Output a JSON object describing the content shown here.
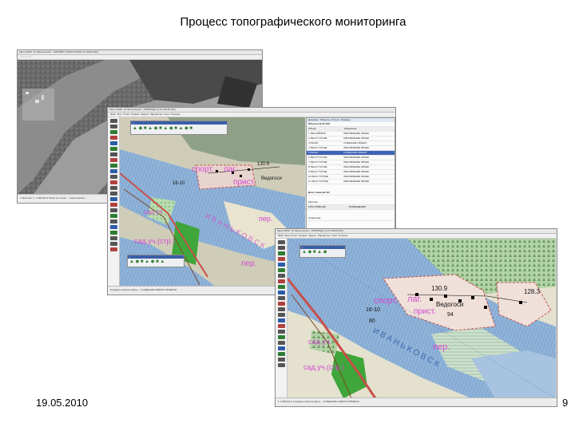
{
  "slide": {
    "title": "Процесс топографического мониторинга",
    "date": "19.05.2010",
    "page_number": "9"
  },
  "screens": {
    "satellite": {
      "window_title": "Карта 2008 - [С:\\Мониторинг\\...\\ОРЛОВО (С\\РИСУНОК\\0-37-109-В-3(Р)]",
      "status": "1 Ярослав. 1 : 9 000,00 м   Поиск по слоям ...  Тематическое ..."
    },
    "middle": {
      "window_title": "Карта 2008 - [С:\\Мониторинг\\...\\ПРИРОДА (0-37-109-В-3(Р)]",
      "menu": [
        "Файл",
        "Вид",
        "Поиск",
        "Правка",
        "Задачи",
        "Параметры",
        "Окно",
        "Помощь"
      ],
      "status": "Создание объекта карты -- СОЗДАНИЕ НОВОГО ОБЪЕКТА",
      "panel_tabs": [
        "Документ",
        "Объекты",
        "Отчеты",
        "Помощь"
      ],
      "panel_heading": "Объекты В-37-109",
      "columns": [
        "Объект",
        "Изменение"
      ],
      "objects": [
        {
          "name": "1 ЛЕССИЙ/ЕЛЬ",
          "change": "ОБНОВЛЕНИЕ ОБЪЕК"
        },
        {
          "name": "2 ЛЕСА ГУСТЫЕ",
          "change": "ОБНОВЛЕНИЕ ОБЪЕК"
        },
        {
          "name": "3 РЕЧКИ",
          "change": "СОЗДАНИЕ ОБЪЕКТ"
        },
        {
          "name": "4 ЛЕСА ГУСТЫЕ",
          "change": "ОБНОВЛЕНИЕ ОБЪЕК"
        },
        {
          "name": "5 РЕЧКИ",
          "change": "СОЗДАНИЕ ОБЪЕКТ"
        },
        {
          "name": "6 ЛЕСА ГУСТЫЕ",
          "change": "ОБНОВЛЕНИЕ ОБЪЕК"
        },
        {
          "name": "7 ЛЕСА ГУСТЫЕ",
          "change": "ОБНОВЛЕНИЕ ОБЪЕК"
        },
        {
          "name": "8 ЛЕСА ГУСТЫЕ",
          "change": "ОБНОВЛЕНИЕ ОБЪЕК"
        },
        {
          "name": "9 ЛЕСА ГУСТЫЕ",
          "change": "ОБНОВЛЕНИЕ ОБЪЕК"
        },
        {
          "name": "10 ЛЕСА ГУСТЫЕ",
          "change": "ОБНОВЛЕНИЕ ОБЪЕК"
        },
        {
          "name": "11 ЛЕСА ГУСТЫЕ",
          "change": "ОБНОВЛЕНИЕ ОБЪЕК"
        }
      ],
      "total_label": "Всего записей 111",
      "bottom_heading": "Метрика",
      "bottom_columns": [
        "КЛЮЧ ВЛЕНИЕ",
        "РАЗМЕЩЕНИЕ"
      ],
      "semantics_label": "Семантика",
      "map_labels": {
        "sport": "спорт.",
        "lag": "лаг.",
        "prist": "прист.",
        "per1": "пер.",
        "per2": "пер.",
        "vedogosi": "Ведогоси",
        "h130": "130.9",
        "s_u": "сад.уч.",
        "s_t": "сад.уч.(стр.)",
        "num1": "16-10",
        "river": "И В А Н Ь К О В С К"
      }
    },
    "front": {
      "window_title": "Карта 2008 - [С:\\Мониторинг\\...\\ПРИРОДА (0-37-109-В-3(Р)]",
      "menu": [
        "Файл",
        "Вид",
        "Поиск",
        "Правка",
        "Задачи",
        "Параметры",
        "Окно",
        "Помощь"
      ],
      "status": "1: 9 000,00 м   Создание объекта карты -- СОЗДАНИЕ НОВОГО ОБЪЕКТА",
      "map_labels": {
        "sport": "спорт.",
        "lag": "лаг.",
        "prist": "прист.",
        "per": "пер.",
        "vedogosi": "Ведогоси",
        "h130": "130.9",
        "h128": "128.3",
        "h94": "94",
        "num1": "16-10",
        "num2": "80",
        "s_u": "сад.уч.",
        "s_t": "сад.уч.(стр.)",
        "river": "И В А Н Ь К О В С К"
      }
    }
  },
  "colors": {
    "water": "#8fb3d9",
    "land": "#dcdccb",
    "forest_green": "#3ea63a",
    "field_green": "#b8dbb0",
    "label_magenta": "#d34ad1",
    "road_red": "#c84f4a",
    "selection_blue": "#3d63b8"
  }
}
